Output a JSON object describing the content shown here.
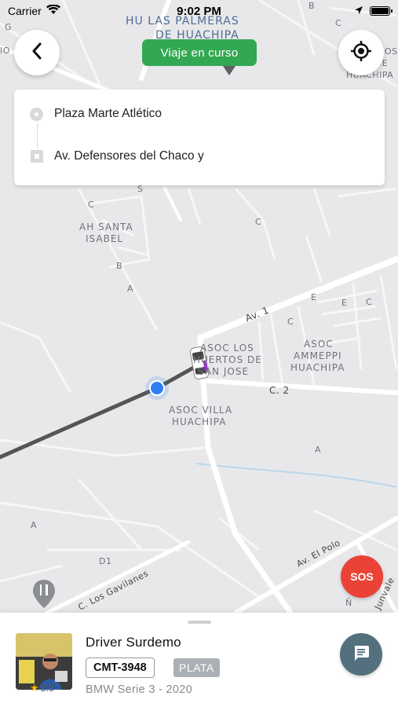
{
  "status_bar": {
    "carrier": "Carrier",
    "time": "9:02 PM"
  },
  "map": {
    "labels": {
      "neighborhood_top_1": "HU LAS PALMERAS",
      "neighborhood_top_2": "DE HUACHIPA",
      "area_santa_isabel_1": "AH SANTA",
      "area_santa_isabel_2": "ISABEL",
      "area_huertos_1": "ASOC LOS",
      "area_huertos_2": "HUERTOS DE",
      "area_huertos_3": "SAN JOSE",
      "area_ammeppi_1": "ASOC",
      "area_ammeppi_2": "AMMEPPI",
      "area_ammeppi_3": "HUACHIPA",
      "area_villa_1": "ASOC VILLA",
      "area_villa_2": "HUACHIPA",
      "area_right_1": "OS",
      "area_right_2": "DOS DE",
      "area_right_3": "HUACHIPA",
      "road_av1": "Av. 1",
      "road_c2": "C. 2",
      "road_elpolo": "Av. El Polo",
      "road_gavilanes": "C. Los Gavilanes",
      "road_right": "Junvale",
      "block_b_top": "B",
      "block_s_top": "S",
      "block_c_top": "C",
      "block_s": "S",
      "block_c1": "C",
      "block_c2": "C",
      "block_b": "B",
      "block_a1": "A",
      "block_e1": "E",
      "block_e2": "E",
      "block_c3": "C",
      "block_c4": "C",
      "block_a2": "A",
      "block_a3": "A",
      "block_d1": "D1",
      "block_n": "Ñ",
      "block_o_left": "IO",
      "block_g": "G"
    }
  },
  "trip_status": "Viaje en curso",
  "route": {
    "origin": "Plaza Marte Atlético",
    "destination": "Av. Defensores del Chaco y"
  },
  "sos_label": "SOS",
  "driver": {
    "name": "Driver Surdemo",
    "rating": "3.5",
    "plate": "CMT-3948",
    "tier": "PLATA",
    "car": "BMW Serie 3 - 2020"
  },
  "colors": {
    "trip_pill": "#33a852",
    "sos": "#ea4335",
    "chat_button": "#54707f",
    "user_location": "#2f7ff1",
    "route_line": "#555555"
  }
}
